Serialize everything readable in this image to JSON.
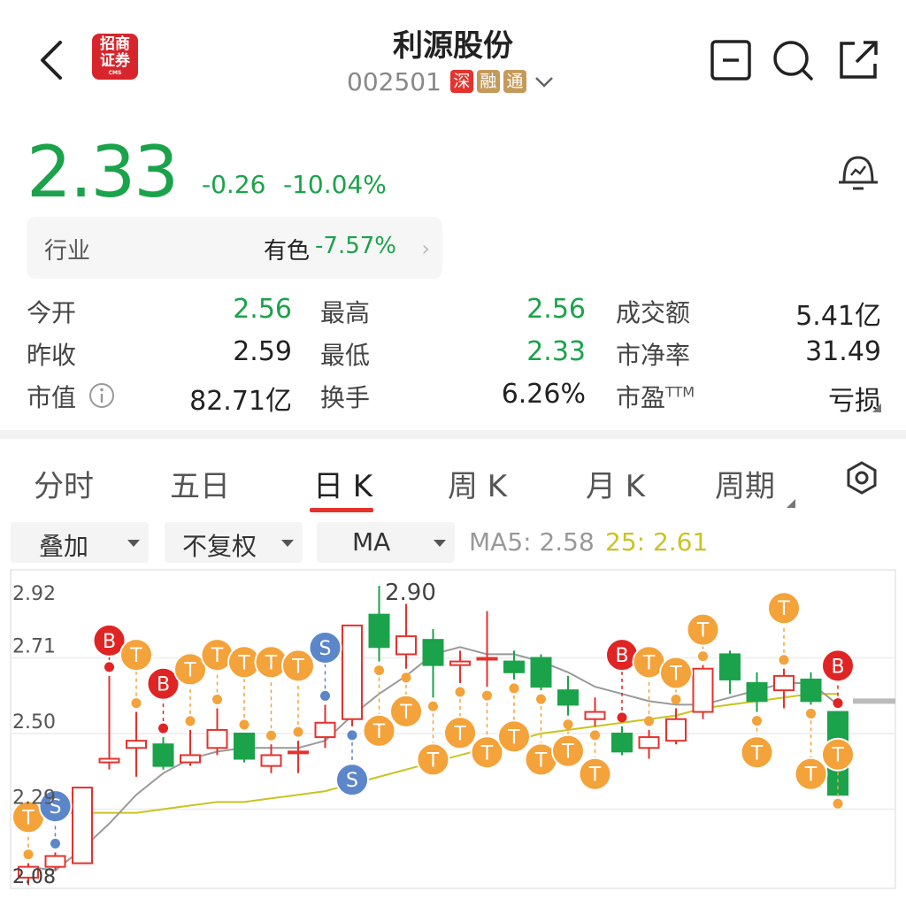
{
  "header": {
    "title": "利源股份",
    "code": "002501",
    "tags": [
      "深",
      "融",
      "通"
    ],
    "logo": {
      "line1": "招商",
      "line2": "证券",
      "line3": "CMS"
    }
  },
  "quote": {
    "price": "2.33",
    "change": "-0.26",
    "change_pct": "-10.04%",
    "color_down": "#1aa34a",
    "color_up": "#e5322d"
  },
  "industry": {
    "label": "行业",
    "name": "有色",
    "pct": "-7.57%"
  },
  "stats": [
    {
      "label": "今开",
      "value": "2.56",
      "tone": "green"
    },
    {
      "label": "最高",
      "value": "2.56",
      "tone": "green"
    },
    {
      "label": "成交额",
      "value": "5.41亿",
      "tone": "dark"
    },
    {
      "label": "昨收",
      "value": "2.59",
      "tone": "dark"
    },
    {
      "label": "最低",
      "value": "2.33",
      "tone": "green"
    },
    {
      "label": "市净率",
      "value": "31.49",
      "tone": "dark"
    },
    {
      "label": "市值",
      "value": "82.71亿",
      "tone": "dark"
    },
    {
      "label": "换手",
      "value": "6.26%",
      "tone": "dark"
    },
    {
      "label": "市盈",
      "sup": "TTM",
      "value": "亏损",
      "tone": "dark"
    }
  ],
  "tabs": [
    "分时",
    "五日",
    "日 K",
    "周 K",
    "月 K",
    "周期"
  ],
  "active_tab": "日 K",
  "controls": {
    "overlay": "叠加",
    "adjust": "不复权",
    "indicator": "MA"
  },
  "ma_legend": {
    "ma5": "MA5: 2.58",
    "ma25": "25: 2.61"
  },
  "chart_data": {
    "type": "candlestick",
    "y_ticks": [
      "2.92",
      "2.71",
      "2.50",
      "2.29",
      "2.08"
    ],
    "high_label": "2.90",
    "low_label": "2.08",
    "candles": [
      {
        "o": 2.1,
        "c": 2.13,
        "h": 2.14,
        "l": 2.08
      },
      {
        "o": 2.13,
        "c": 2.16,
        "h": 2.17,
        "l": 2.12
      },
      {
        "o": 2.14,
        "c": 2.35,
        "h": 2.35,
        "l": 2.14
      },
      {
        "o": 2.42,
        "c": 2.43,
        "h": 2.66,
        "l": 2.4
      },
      {
        "o": 2.46,
        "c": 2.48,
        "h": 2.56,
        "l": 2.38
      },
      {
        "o": 2.47,
        "c": 2.41,
        "h": 2.49,
        "l": 2.4
      },
      {
        "o": 2.42,
        "c": 2.44,
        "h": 2.51,
        "l": 2.41
      },
      {
        "o": 2.46,
        "c": 2.51,
        "h": 2.57,
        "l": 2.44
      },
      {
        "o": 2.5,
        "c": 2.43,
        "h": 2.5,
        "l": 2.42
      },
      {
        "o": 2.41,
        "c": 2.44,
        "h": 2.47,
        "l": 2.39
      },
      {
        "o": 2.45,
        "c": 2.45,
        "h": 2.48,
        "l": 2.39
      },
      {
        "o": 2.49,
        "c": 2.53,
        "h": 2.58,
        "l": 2.46
      },
      {
        "o": 2.54,
        "c": 2.8,
        "h": 2.8,
        "l": 2.52
      },
      {
        "o": 2.83,
        "c": 2.74,
        "h": 2.91,
        "l": 2.7
      },
      {
        "o": 2.72,
        "c": 2.77,
        "h": 2.86,
        "l": 2.68
      },
      {
        "o": 2.76,
        "c": 2.69,
        "h": 2.79,
        "l": 2.6
      },
      {
        "o": 2.69,
        "c": 2.7,
        "h": 2.73,
        "l": 2.64
      },
      {
        "o": 2.71,
        "c": 2.71,
        "h": 2.84,
        "l": 2.63
      },
      {
        "o": 2.7,
        "c": 2.67,
        "h": 2.73,
        "l": 2.65
      },
      {
        "o": 2.71,
        "c": 2.63,
        "h": 2.72,
        "l": 2.62
      },
      {
        "o": 2.62,
        "c": 2.58,
        "h": 2.66,
        "l": 2.55
      },
      {
        "o": 2.54,
        "c": 2.56,
        "h": 2.6,
        "l": 2.52
      },
      {
        "o": 2.5,
        "c": 2.45,
        "h": 2.52,
        "l": 2.44
      },
      {
        "o": 2.46,
        "c": 2.49,
        "h": 2.51,
        "l": 2.43
      },
      {
        "o": 2.48,
        "c": 2.54,
        "h": 2.57,
        "l": 2.47
      },
      {
        "o": 2.56,
        "c": 2.68,
        "h": 2.69,
        "l": 2.54
      },
      {
        "o": 2.72,
        "c": 2.65,
        "h": 2.73,
        "l": 2.61
      },
      {
        "o": 2.64,
        "c": 2.59,
        "h": 2.67,
        "l": 2.56
      },
      {
        "o": 2.62,
        "c": 2.66,
        "h": 2.68,
        "l": 2.57
      },
      {
        "o": 2.65,
        "c": 2.59,
        "h": 2.67,
        "l": 2.58
      },
      {
        "o": 2.56,
        "c": 2.33,
        "h": 2.56,
        "l": 2.33
      }
    ],
    "ma5": [
      2.13,
      2.12,
      2.18,
      2.25,
      2.33,
      2.39,
      2.43,
      2.45,
      2.46,
      2.46,
      2.46,
      2.48,
      2.55,
      2.61,
      2.66,
      2.72,
      2.74,
      2.72,
      2.72,
      2.7,
      2.67,
      2.63,
      2.61,
      2.59,
      2.58,
      2.58,
      2.6,
      2.62,
      2.64,
      2.64,
      2.58
    ],
    "ma25": [
      2.29,
      2.28,
      2.28,
      2.28,
      2.28,
      2.29,
      2.3,
      2.31,
      2.31,
      2.32,
      2.33,
      2.34,
      2.36,
      2.38,
      2.4,
      2.42,
      2.44,
      2.46,
      2.48,
      2.5,
      2.51,
      2.52,
      2.53,
      2.54,
      2.55,
      2.57,
      2.58,
      2.59,
      2.6,
      2.61,
      2.61
    ],
    "markers": [
      {
        "i": 0,
        "type": "T",
        "side": "above",
        "y": 2.17
      },
      {
        "i": 1,
        "type": "S",
        "side": "above",
        "y": 2.2
      },
      {
        "i": 3,
        "type": "B",
        "side": "above",
        "y": 2.66
      },
      {
        "i": 4,
        "type": "T",
        "side": "above",
        "y": 2.62
      },
      {
        "i": 5,
        "type": "B",
        "side": "above",
        "y": 2.54
      },
      {
        "i": 6,
        "type": "T",
        "side": "above",
        "y": 2.58
      },
      {
        "i": 7,
        "type": "T",
        "side": "above",
        "y": 2.62
      },
      {
        "i": 8,
        "type": "T",
        "side": "above",
        "y": 2.6
      },
      {
        "i": 9,
        "type": "T",
        "side": "above",
        "y": 2.6
      },
      {
        "i": 10,
        "type": "T",
        "side": "above",
        "y": 2.59
      },
      {
        "i": 11,
        "type": "S",
        "side": "above",
        "y": 2.64
      },
      {
        "i": 12,
        "type": "S",
        "side": "below",
        "y": 2.47
      },
      {
        "i": 13,
        "type": "T",
        "side": "below",
        "y": 2.66
      },
      {
        "i": 14,
        "type": "T",
        "side": "below",
        "y": 2.66
      },
      {
        "i": 15,
        "type": "T",
        "side": "below",
        "y": 2.58
      },
      {
        "i": 16,
        "type": "T",
        "side": "below",
        "y": 2.6
      },
      {
        "i": 17,
        "type": "T",
        "side": "below",
        "y": 2.6
      },
      {
        "i": 18,
        "type": "T",
        "side": "below",
        "y": 2.59
      },
      {
        "i": 19,
        "type": "T",
        "side": "below",
        "y": 2.58
      },
      {
        "i": 20,
        "type": "T",
        "side": "below",
        "y": 2.55
      },
      {
        "i": 21,
        "type": "T",
        "side": "below",
        "y": 2.54
      },
      {
        "i": 22,
        "type": "B",
        "side": "above",
        "y": 2.62
      },
      {
        "i": 23,
        "type": "T",
        "side": "above",
        "y": 2.6
      },
      {
        "i": 24,
        "type": "T",
        "side": "above",
        "y": 2.56
      },
      {
        "i": 25,
        "type": "T",
        "side": "above",
        "y": 2.54
      },
      {
        "i": 27,
        "type": "T",
        "side": "below",
        "y": 2.6
      },
      {
        "i": 28,
        "type": "T",
        "side": "above",
        "y": 2.75
      },
      {
        "i": 29,
        "type": "T",
        "side": "below",
        "y": 2.54
      },
      {
        "i": 30,
        "type": "T",
        "side": "below",
        "y": 2.54
      },
      {
        "i": 31,
        "type": "B",
        "side": "above",
        "y": 2.59
      }
    ]
  }
}
